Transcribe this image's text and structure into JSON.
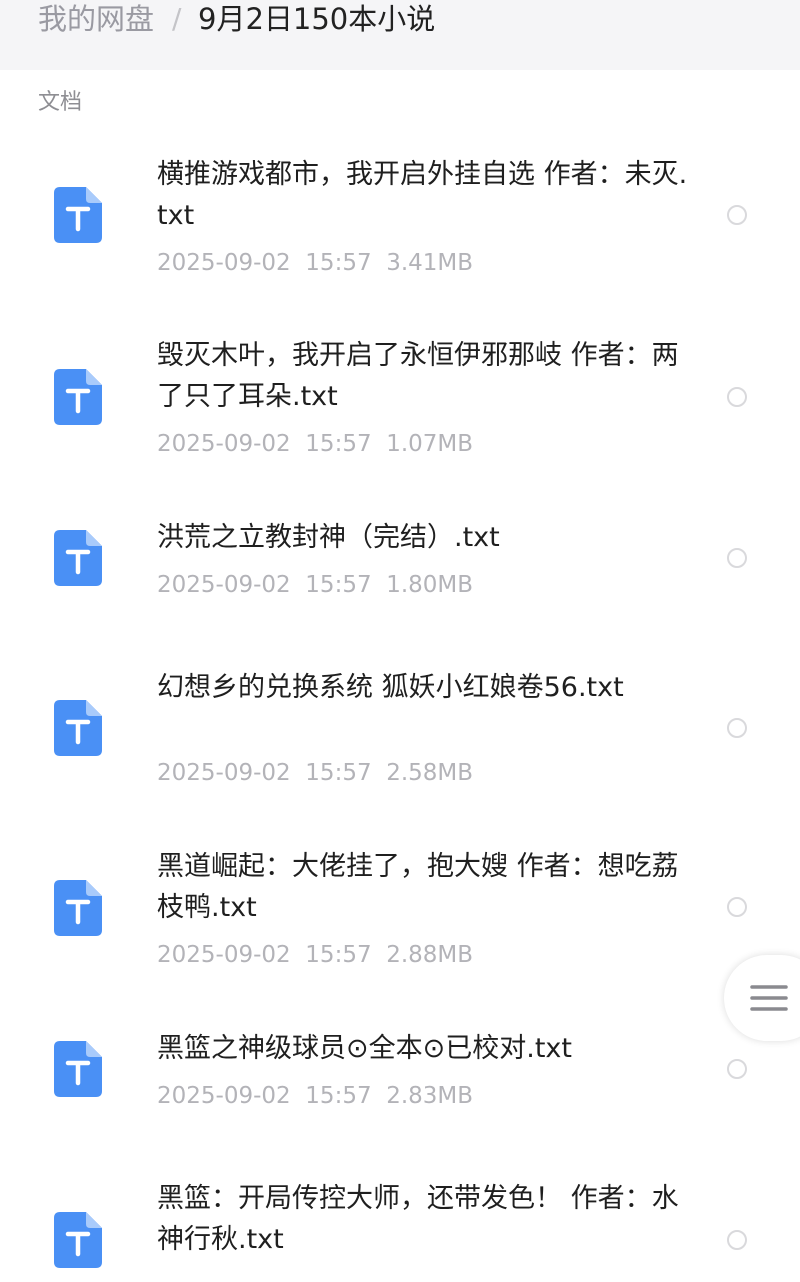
{
  "header": {
    "breadcrumb_root": "我的网盘",
    "breadcrumb_separator": "/",
    "current_folder": "9月2日150本小说"
  },
  "section": {
    "label": "文档"
  },
  "files": [
    {
      "name": "横推游戏都市，我开启外挂自选 作者：未灭.txt",
      "date": "2025-09-02",
      "time": "15:57",
      "size": "3.41MB"
    },
    {
      "name": "毁灭木叶，我开启了永恒伊邪那岐 作者：两了只了耳朵.txt",
      "date": "2025-09-02",
      "time": "15:57",
      "size": "1.07MB"
    },
    {
      "name": "洪荒之立教封神（完结）.txt",
      "date": "2025-09-02",
      "time": "15:57",
      "size": "1.80MB"
    },
    {
      "name": "幻想乡的兑换系统 狐妖小红娘卷56.txt",
      "date": "2025-09-02",
      "time": "15:57",
      "size": "2.58MB"
    },
    {
      "name": "黑道崛起：大佬挂了，抱大嫂 作者：想吃荔枝鸭.txt",
      "date": "2025-09-02",
      "time": "15:57",
      "size": "2.88MB"
    },
    {
      "name": "黑篮之神级球员⊙全本⊙已校对.txt",
      "date": "2025-09-02",
      "time": "15:57",
      "size": "2.83MB"
    },
    {
      "name": "黑篮：开局传控大师，还带发色！ 作者：水神行秋.txt",
      "date": "",
      "time": "",
      "size": ""
    }
  ],
  "colors": {
    "icon_blue": "#4a90f5",
    "icon_fold": "#a9cbfb"
  },
  "icons": {
    "file_type": "txt-file-icon",
    "floating_menu": "hamburger-menu-icon"
  }
}
